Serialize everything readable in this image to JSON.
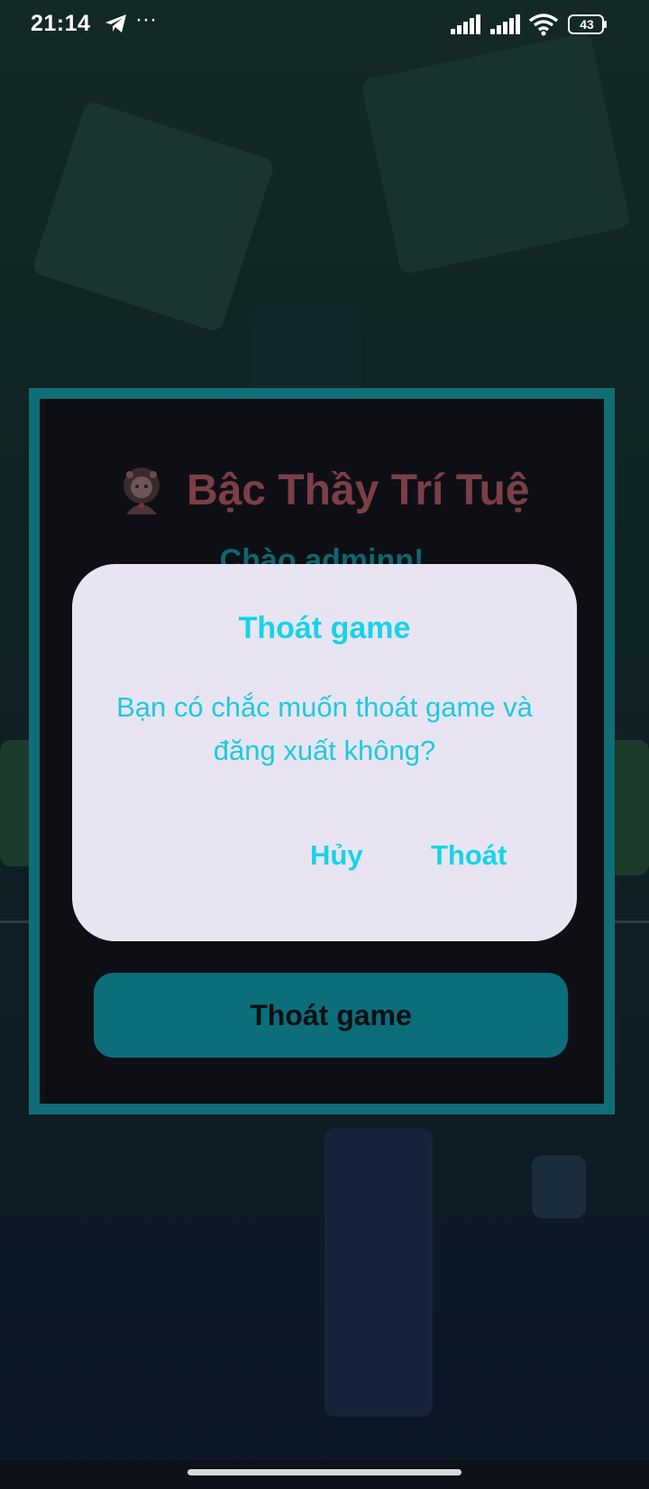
{
  "status_bar": {
    "time": "21:14",
    "overflow": "···",
    "battery": "43",
    "icons": [
      "telegram-icon",
      "signal-icon",
      "signal-icon",
      "wifi-icon",
      "battery-icon"
    ]
  },
  "panel": {
    "title": "Bậc Thầy Trí Tuệ",
    "greeting": "Chào adminn!",
    "exit_button": "Thoát game",
    "border_color": "#0f6e76"
  },
  "dialog": {
    "title": "Thoát game",
    "message": "Bạn có chắc muốn thoát game và đăng xuất không?",
    "cancel": "Hủy",
    "confirm": "Thoát",
    "accent_color": "#16d3ea"
  }
}
